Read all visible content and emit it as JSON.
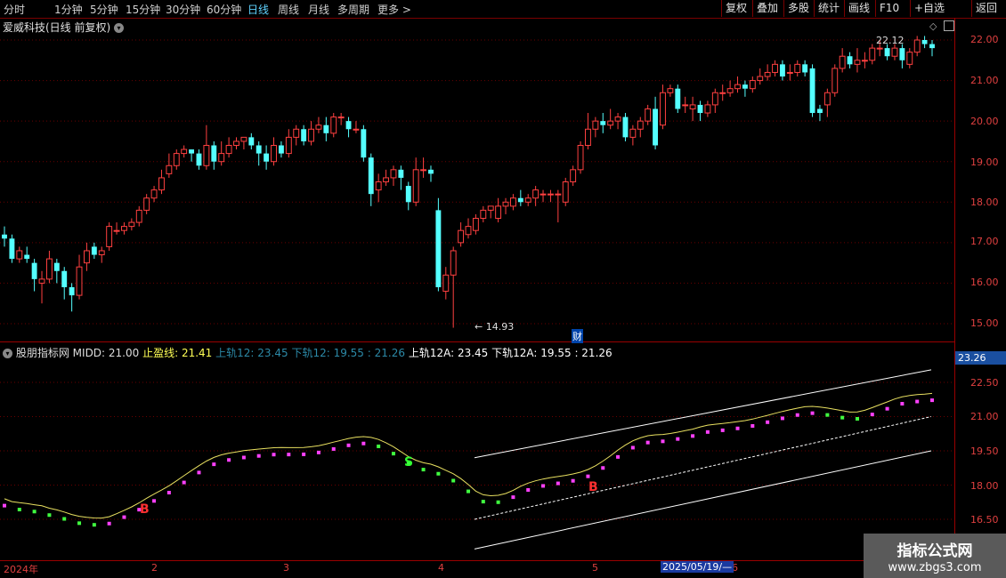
{
  "toolbar": {
    "periods": [
      "分时",
      "1分钟",
      "5分钟",
      "15分钟",
      "30分钟",
      "60分钟",
      "日线",
      "周线",
      "月线",
      "多周期",
      "更多 >"
    ],
    "active_period": "日线",
    "right_buttons": [
      "复权",
      "叠加",
      "多股",
      "统计",
      "画线",
      "F10",
      "+自选",
      "返回"
    ]
  },
  "chart": {
    "title": "爱威科技(日线 前复权)",
    "price_ticks": [
      "22.00",
      "21.00",
      "20.00",
      "19.00",
      "18.00",
      "17.00",
      "16.00",
      "15.00"
    ],
    "high_label": "22.12",
    "low_label": "14.93",
    "cai_badge": "财"
  },
  "indicator": {
    "name": "股朋指标网",
    "midd": "MIDD: 21.00",
    "stop": "止盈线: 21.41",
    "upper12": "上轨12: 23.45",
    "lower12": "下轨12: 19.55",
    "val1": ": 21.26",
    "upper12a": "上轨12A: 23.45",
    "lower12a": "下轨12A: 19.55",
    "val2": ": 21.26",
    "current": "23.26",
    "ticks": [
      "22.50",
      "21.00",
      "19.50",
      "18.00",
      "16.50"
    ],
    "b_label": "B",
    "s_label": "S"
  },
  "xaxis": {
    "labels": [
      "2024年",
      "2",
      "3",
      "4",
      "5",
      "6"
    ],
    "cursor_date": "2025/05/19/—"
  },
  "watermark": {
    "line1": "指标公式网",
    "line2": "www.zbgs3.com"
  },
  "colors": {
    "up": "#ff4040",
    "down": "#54ffff",
    "grid": "#6a0000"
  },
  "chart_data": {
    "type": "candlestick",
    "candles": [
      [
        17.2,
        17.1,
        17.4,
        16.9
      ],
      [
        17.1,
        16.6,
        17.2,
        16.5
      ],
      [
        16.6,
        16.8,
        16.9,
        16.5
      ],
      [
        16.7,
        16.6,
        16.9,
        16.5
      ],
      [
        16.5,
        16.1,
        16.6,
        15.8
      ],
      [
        16.0,
        16.1,
        16.3,
        15.5
      ],
      [
        16.1,
        16.6,
        16.8,
        16.0
      ],
      [
        16.5,
        16.3,
        16.6,
        16.0
      ],
      [
        16.3,
        15.9,
        16.4,
        15.6
      ],
      [
        15.9,
        15.7,
        16.0,
        15.3
      ],
      [
        15.7,
        16.4,
        16.7,
        15.6
      ],
      [
        16.5,
        16.8,
        17.0,
        16.3
      ],
      [
        16.9,
        16.7,
        17.0,
        16.6
      ],
      [
        16.7,
        16.8,
        16.9,
        16.5
      ],
      [
        16.9,
        17.4,
        17.5,
        16.8
      ],
      [
        17.3,
        17.3,
        17.5,
        17.2
      ],
      [
        17.3,
        17.4,
        17.5,
        17.2
      ],
      [
        17.4,
        17.5,
        17.6,
        17.3
      ],
      [
        17.5,
        17.8,
        17.9,
        17.4
      ],
      [
        17.8,
        18.1,
        18.2,
        17.7
      ],
      [
        18.1,
        18.3,
        18.4,
        18.0
      ],
      [
        18.3,
        18.6,
        18.8,
        18.2
      ],
      [
        18.7,
        18.9,
        19.2,
        18.6
      ],
      [
        18.9,
        19.2,
        19.3,
        18.8
      ],
      [
        19.2,
        19.3,
        19.4,
        19.1
      ],
      [
        19.3,
        19.2,
        19.3,
        19.0
      ],
      [
        19.2,
        18.9,
        19.3,
        18.8
      ],
      [
        18.9,
        19.4,
        19.9,
        18.8
      ],
      [
        19.4,
        19.0,
        19.5,
        18.8
      ],
      [
        19.0,
        19.2,
        19.5,
        18.9
      ],
      [
        19.2,
        19.4,
        19.6,
        19.1
      ],
      [
        19.4,
        19.5,
        19.6,
        19.3
      ],
      [
        19.5,
        19.6,
        19.6,
        19.3
      ],
      [
        19.6,
        19.4,
        19.7,
        19.3
      ],
      [
        19.4,
        19.2,
        19.5,
        18.9
      ],
      [
        19.2,
        19.0,
        19.4,
        18.8
      ],
      [
        19.0,
        19.4,
        19.6,
        18.9
      ],
      [
        19.4,
        19.2,
        19.5,
        19.1
      ],
      [
        19.2,
        19.6,
        19.8,
        19.1
      ],
      [
        19.6,
        19.8,
        19.9,
        19.4
      ],
      [
        19.8,
        19.5,
        19.9,
        19.4
      ],
      [
        19.5,
        19.8,
        20.0,
        19.4
      ],
      [
        19.8,
        19.9,
        20.1,
        19.7
      ],
      [
        19.9,
        19.7,
        20.1,
        19.5
      ],
      [
        19.7,
        20.1,
        20.2,
        19.6
      ],
      [
        20.1,
        20.1,
        20.2,
        19.9
      ],
      [
        20.0,
        19.8,
        20.1,
        19.6
      ],
      [
        19.8,
        19.8,
        20.0,
        19.7
      ],
      [
        19.8,
        19.1,
        19.9,
        19.0
      ],
      [
        19.1,
        18.2,
        19.2,
        17.9
      ],
      [
        18.3,
        18.5,
        18.7,
        18.0
      ],
      [
        18.5,
        18.6,
        18.8,
        18.4
      ],
      [
        18.6,
        18.8,
        18.9,
        18.4
      ],
      [
        18.8,
        18.6,
        18.9,
        18.3
      ],
      [
        18.4,
        18.0,
        18.5,
        17.8
      ],
      [
        18.0,
        18.8,
        19.1,
        17.9
      ],
      [
        18.8,
        18.8,
        19.1,
        18.6
      ],
      [
        18.8,
        18.7,
        18.9,
        18.5
      ],
      [
        17.8,
        15.9,
        18.1,
        15.8
      ],
      [
        15.8,
        16.2,
        16.4,
        15.6
      ],
      [
        16.2,
        16.8,
        16.9,
        14.9
      ],
      [
        17.0,
        17.3,
        17.5,
        16.9
      ],
      [
        17.2,
        17.4,
        17.6,
        17.1
      ],
      [
        17.3,
        17.6,
        17.7,
        17.2
      ],
      [
        17.6,
        17.8,
        17.9,
        17.5
      ],
      [
        17.8,
        17.9,
        17.9,
        17.6
      ],
      [
        17.6,
        17.9,
        18.1,
        17.5
      ],
      [
        17.9,
        18.0,
        18.1,
        17.7
      ],
      [
        17.9,
        18.1,
        18.2,
        17.8
      ],
      [
        18.1,
        18.0,
        18.3,
        17.9
      ],
      [
        18.0,
        18.1,
        18.2,
        17.9
      ],
      [
        18.1,
        18.3,
        18.4,
        17.9
      ],
      [
        18.2,
        18.2,
        18.3,
        18.0
      ],
      [
        18.2,
        18.2,
        18.3,
        18.0
      ],
      [
        18.2,
        18.2,
        18.3,
        17.5
      ],
      [
        18.0,
        18.5,
        18.6,
        17.9
      ],
      [
        18.5,
        18.8,
        18.9,
        18.4
      ],
      [
        18.8,
        19.4,
        19.5,
        18.7
      ],
      [
        19.4,
        19.8,
        20.2,
        19.3
      ],
      [
        19.8,
        20.0,
        20.1,
        19.6
      ],
      [
        20.0,
        19.9,
        20.2,
        19.7
      ],
      [
        19.9,
        20.0,
        20.3,
        19.8
      ],
      [
        20.0,
        20.1,
        20.2,
        19.8
      ],
      [
        20.1,
        19.6,
        20.2,
        19.5
      ],
      [
        19.6,
        19.8,
        19.9,
        19.4
      ],
      [
        19.8,
        20.0,
        20.1,
        19.6
      ],
      [
        20.0,
        20.3,
        20.4,
        19.9
      ],
      [
        20.3,
        19.4,
        20.6,
        19.3
      ],
      [
        19.9,
        20.7,
        20.9,
        19.8
      ],
      [
        20.7,
        20.8,
        20.9,
        20.6
      ],
      [
        20.8,
        20.3,
        20.9,
        20.2
      ],
      [
        20.4,
        20.4,
        20.6,
        20.2
      ],
      [
        20.3,
        20.4,
        20.6,
        20.0
      ],
      [
        20.4,
        20.2,
        20.5,
        20.0
      ],
      [
        20.2,
        20.4,
        20.5,
        20.1
      ],
      [
        20.4,
        20.7,
        20.8,
        20.2
      ],
      [
        20.7,
        20.7,
        20.9,
        20.5
      ],
      [
        20.7,
        20.8,
        21.0,
        20.6
      ],
      [
        20.8,
        20.9,
        21.1,
        20.7
      ],
      [
        20.9,
        20.8,
        21.0,
        20.6
      ],
      [
        20.8,
        21.0,
        21.1,
        20.7
      ],
      [
        21.0,
        21.1,
        21.3,
        20.9
      ],
      [
        21.1,
        21.2,
        21.4,
        21.0
      ],
      [
        21.2,
        21.4,
        21.5,
        21.1
      ],
      [
        21.4,
        21.1,
        21.5,
        21.0
      ],
      [
        21.2,
        21.2,
        21.4,
        21.0
      ],
      [
        21.2,
        21.4,
        21.5,
        21.1
      ],
      [
        21.4,
        21.2,
        21.5,
        21.1
      ],
      [
        21.3,
        20.2,
        21.4,
        20.1
      ],
      [
        20.3,
        20.2,
        20.4,
        20.0
      ],
      [
        20.4,
        20.7,
        20.8,
        20.1
      ],
      [
        20.7,
        21.3,
        21.4,
        20.6
      ],
      [
        21.3,
        21.6,
        21.8,
        21.2
      ],
      [
        21.6,
        21.4,
        21.7,
        21.3
      ],
      [
        21.4,
        21.5,
        21.8,
        21.2
      ],
      [
        21.5,
        21.5,
        21.7,
        21.3
      ],
      [
        21.5,
        21.8,
        21.9,
        21.4
      ],
      [
        21.8,
        21.8,
        22.0,
        21.6
      ],
      [
        21.8,
        21.6,
        21.9,
        21.5
      ],
      [
        21.6,
        21.8,
        21.9,
        21.5
      ],
      [
        21.8,
        21.5,
        21.9,
        21.3
      ],
      [
        21.4,
        21.7,
        21.8,
        21.3
      ],
      [
        21.7,
        22.0,
        22.1,
        21.6
      ],
      [
        22.0,
        21.9,
        22.1,
        21.8
      ],
      [
        21.9,
        21.8,
        22.0,
        21.6
      ]
    ]
  }
}
